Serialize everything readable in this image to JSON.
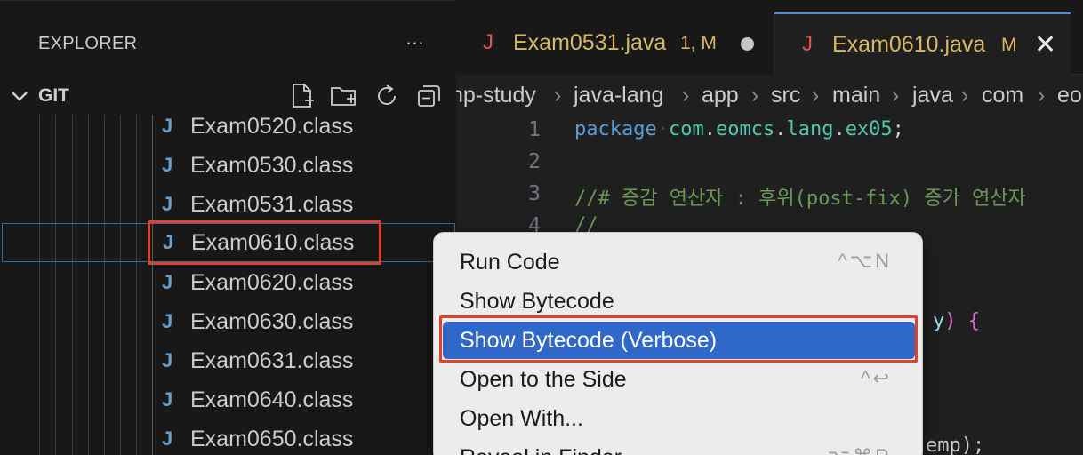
{
  "sidebar": {
    "title": "EXPLORER",
    "more_icon": "…",
    "section": {
      "title": "GIT",
      "tools": [
        "new-file-icon",
        "new-folder-icon",
        "refresh-icon",
        "collapse-all-icon"
      ]
    },
    "files": [
      {
        "icon": "J",
        "name": "Exam0520.class"
      },
      {
        "icon": "J",
        "name": "Exam0530.class"
      },
      {
        "icon": "J",
        "name": "Exam0531.class"
      },
      {
        "icon": "J",
        "name": "Exam0610.class"
      },
      {
        "icon": "J",
        "name": "Exam0620.class"
      },
      {
        "icon": "J",
        "name": "Exam0630.class"
      },
      {
        "icon": "J",
        "name": "Exam0631.class"
      },
      {
        "icon": "J",
        "name": "Exam0640.class"
      },
      {
        "icon": "J",
        "name": "Exam0650.class"
      }
    ]
  },
  "tabs": [
    {
      "icon": "J",
      "label": "Exam0531.java",
      "status": "1, M"
    },
    {
      "icon": "J",
      "label": "Exam0610.java",
      "status": "M"
    }
  ],
  "breadcrumb": [
    "np-study",
    "java-lang",
    "app",
    "src",
    "main",
    "java",
    "com",
    "eo"
  ],
  "editor": {
    "line_numbers": [
      "1",
      "2",
      "3",
      "4"
    ],
    "line1": {
      "keyword": "package",
      "pkg1": "com",
      "pkg2": "eomcs",
      "pkg3": "lang",
      "pkg4": "ex05",
      "end": ";"
    },
    "line3": "//# 증감 연산자 : 후위(post-fix) 증가 연산자",
    "line4": "//",
    "fragment_ident": "y",
    "fragment_paren": ")",
    "fragment_brace": "{",
    "fragment_bottom": "emp);"
  },
  "context_menu": {
    "items": [
      {
        "label": "Run Code",
        "shortcut": "^⌥N"
      },
      {
        "label": "Show Bytecode",
        "shortcut": ""
      },
      {
        "label": "Show Bytecode (Verbose)",
        "shortcut": ""
      },
      {
        "label": "Open to the Side",
        "shortcut": "^↩"
      },
      {
        "label": "Open With...",
        "shortcut": ""
      },
      {
        "label": "Reveal in Finder",
        "shortcut": "⌥⌘R"
      }
    ]
  },
  "colors": {
    "accent": "#2f68c8",
    "highlight_box": "#e0412b",
    "modified": "#d8b860",
    "java_icon": "#e05252"
  }
}
